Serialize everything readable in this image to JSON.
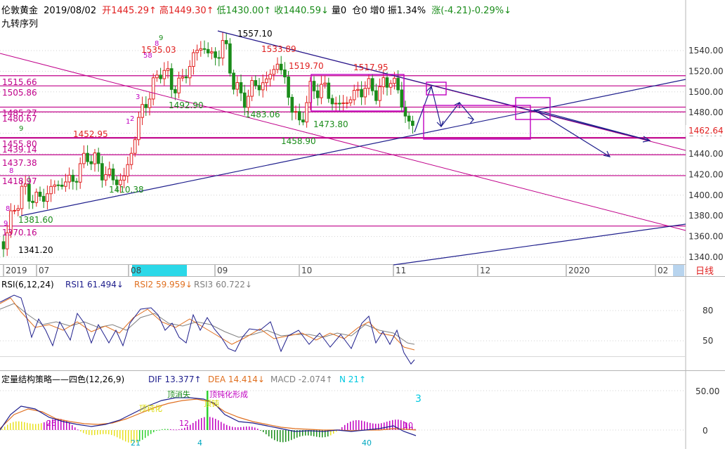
{
  "header": {
    "instrument": "伦敦黄金",
    "date": "2019/08/02",
    "open": "开1445.29↑",
    "high": "高1449.30↑",
    "low": "低1430.00↑",
    "close": "收1440.59↓",
    "volume": "量0",
    "position": "仓0",
    "increase": "增0",
    "amplitude": "振1.34%",
    "change": "涨(-4.21)-0.29%↓",
    "indicator_name": "九转序列"
  },
  "colors": {
    "red": "#e02020",
    "green": "#1a8c1a",
    "navy": "#1e1e8c",
    "magenta": "#c0008a",
    "cyan": "#00c8e0",
    "orange": "#e07020",
    "grid": "#b4b4b4"
  },
  "price_axis": {
    "ticks": [
      "1540.00",
      "1520.00",
      "1500.00",
      "1480.00",
      "1460.00",
      "1440.00",
      "1420.00",
      "1400.00",
      "1380.00",
      "1360.00",
      "1340.00"
    ],
    "current_price": "1462.64"
  },
  "time_axis": {
    "labels": [
      "2019",
      "07",
      "08",
      "09",
      "10",
      "11",
      "12",
      "2020",
      "02"
    ],
    "period_button": "日线"
  },
  "chart_data": [
    {
      "type": "candlestick",
      "title": "伦敦黄金 2019/08/02",
      "ylim": [
        1330,
        1565
      ],
      "price_annotations": [
        "1557.10",
        "1535.03",
        "1533.89",
        "1519.70",
        "1517.95",
        "1515.66",
        "1505.86",
        "1492.90",
        "1485.27",
        "1480.67",
        "1483.06",
        "1473.80",
        "1458.90",
        "1455.80",
        "1452.95",
        "1439.14",
        "1437.38",
        "1418.97",
        "1410.38",
        "1381.60",
        "1370.16",
        "1341.20"
      ],
      "horizontal_levels": [
        1515.66,
        1505.86,
        1485.27,
        1480.67,
        1455.8,
        1455.2,
        1439.14,
        1418.97,
        1370.16
      ],
      "sequence_markers": [
        "9",
        "8",
        "58",
        "3",
        "2",
        "1",
        "9",
        "8",
        "9",
        "8"
      ]
    },
    {
      "type": "line",
      "title": "RSI(6,12,24)",
      "series": [
        {
          "name": "RSI1",
          "label": "RSI1 61.494↓",
          "color": "#1e1e8c"
        },
        {
          "name": "RSI2",
          "label": "RSI2 59.959↓",
          "color": "#e07020"
        },
        {
          "name": "RSI3",
          "label": "RSI3 60.722↓",
          "color": "#808080"
        }
      ],
      "yticks": [
        "80",
        "50"
      ]
    },
    {
      "type": "bar",
      "title": "定量结构策略——四色(12,26,9)",
      "series": [
        {
          "name": "DIF",
          "label": "DIF 13.377↑",
          "color": "#1e1e8c"
        },
        {
          "name": "DEA",
          "label": "DEA 14.414↓",
          "color": "#e07020"
        },
        {
          "name": "MACD",
          "label": "MACD -2.074↑",
          "color": "#808080"
        },
        {
          "name": "N",
          "label": "N 21↑",
          "color": "#00c8e0"
        }
      ],
      "yticks": [
        "50.00",
        "0"
      ],
      "annotations": [
        "顶消失",
        "顶钝化",
        "顶钝化形成",
        "顶钝",
        "3",
        "26",
        "12",
        "10",
        "21",
        "4",
        "40"
      ]
    }
  ]
}
